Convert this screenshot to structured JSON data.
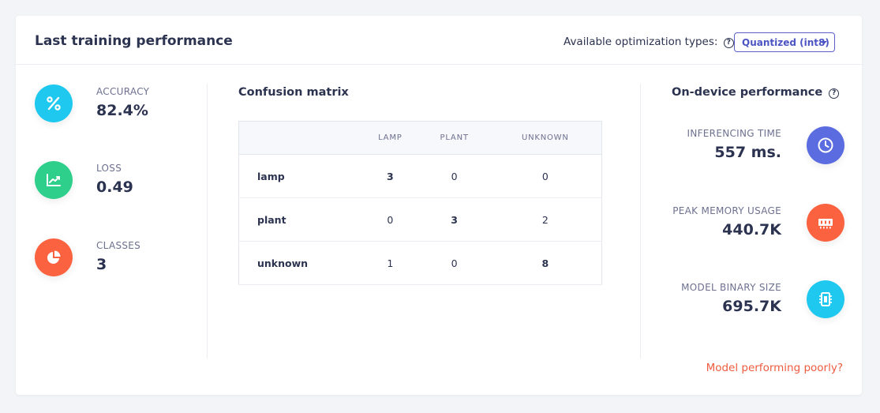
{
  "header": {
    "title": "Last training performance",
    "optimization_label": "Available optimization types:",
    "optimization_selected": "Quantized (int8)"
  },
  "metrics": [
    {
      "label": "ACCURACY",
      "value": "82.4%",
      "icon": "percent-icon",
      "color": "#1ec8ee"
    },
    {
      "label": "LOSS",
      "value": "0.49",
      "icon": "trending-chart-icon",
      "color": "#2dcf8a"
    },
    {
      "label": "CLASSES",
      "value": "3",
      "icon": "pie-chart-icon",
      "color": "#fb6240"
    }
  ],
  "confusion_matrix": {
    "title": "Confusion matrix",
    "columns": [
      "LAMP",
      "PLANT",
      "UNKNOWN"
    ],
    "rows": [
      {
        "label": "lamp",
        "values": [
          "3",
          "0",
          "0"
        ]
      },
      {
        "label": "plant",
        "values": [
          "0",
          "3",
          "2"
        ]
      },
      {
        "label": "unknown",
        "values": [
          "1",
          "0",
          "8"
        ]
      }
    ]
  },
  "on_device": {
    "title": "On-device performance",
    "items": [
      {
        "label": "INFERENCING TIME",
        "value": "557 ms.",
        "icon": "clock-icon",
        "color": "#5b6ce0"
      },
      {
        "label": "PEAK MEMORY USAGE",
        "value": "440.7K",
        "icon": "memory-chip-icon",
        "color": "#fb6240"
      },
      {
        "label": "MODEL BINARY SIZE",
        "value": "695.7K",
        "icon": "microchip-icon",
        "color": "#1ec8ee"
      }
    ]
  },
  "footer": {
    "link": "Model performing poorly?",
    "link_color": "#ef5b3e"
  }
}
